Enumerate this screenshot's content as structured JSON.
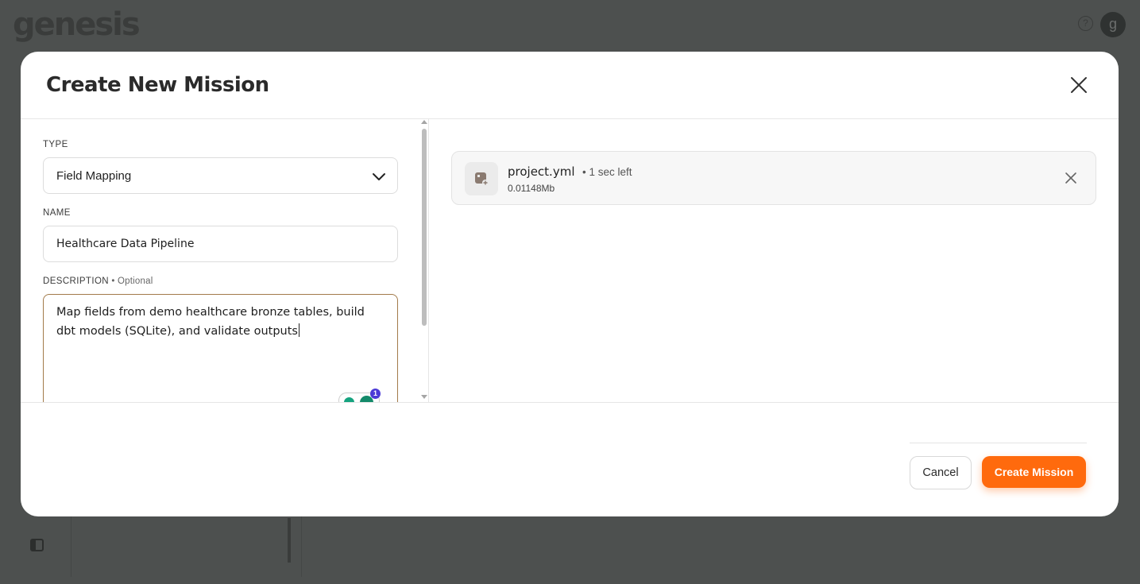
{
  "app": {
    "logo_text": "genesis",
    "help_glyph": "?",
    "avatar_initial": "g"
  },
  "modal": {
    "title": "Create New Mission",
    "type": {
      "label": "TYPE",
      "value": "Field Mapping"
    },
    "name": {
      "label": "NAME",
      "value": "Healthcare Data Pipeline"
    },
    "description": {
      "label": "DESCRIPTION",
      "optional_tag": " • Optional",
      "value": "Map fields from demo healthcare bronze tables, build dbt models (SQLite), and validate outputs"
    },
    "grammarly_badge_count": "1",
    "attachment": {
      "file_name": "project.yml",
      "status": "• 1 sec left",
      "size": "0.01148Mb"
    },
    "cancel_label": "Cancel",
    "submit_label": "Create Mission"
  },
  "colors": {
    "accent": "#ff6a0d",
    "overlay": "#4d504f",
    "focus_border": "#a27a4a"
  },
  "icons": [
    "help-icon",
    "close-icon",
    "chevron-down-icon",
    "file-upload-icon",
    "remove-file-icon",
    "sidebar-toggle-icon",
    "grammarly-icon"
  ]
}
